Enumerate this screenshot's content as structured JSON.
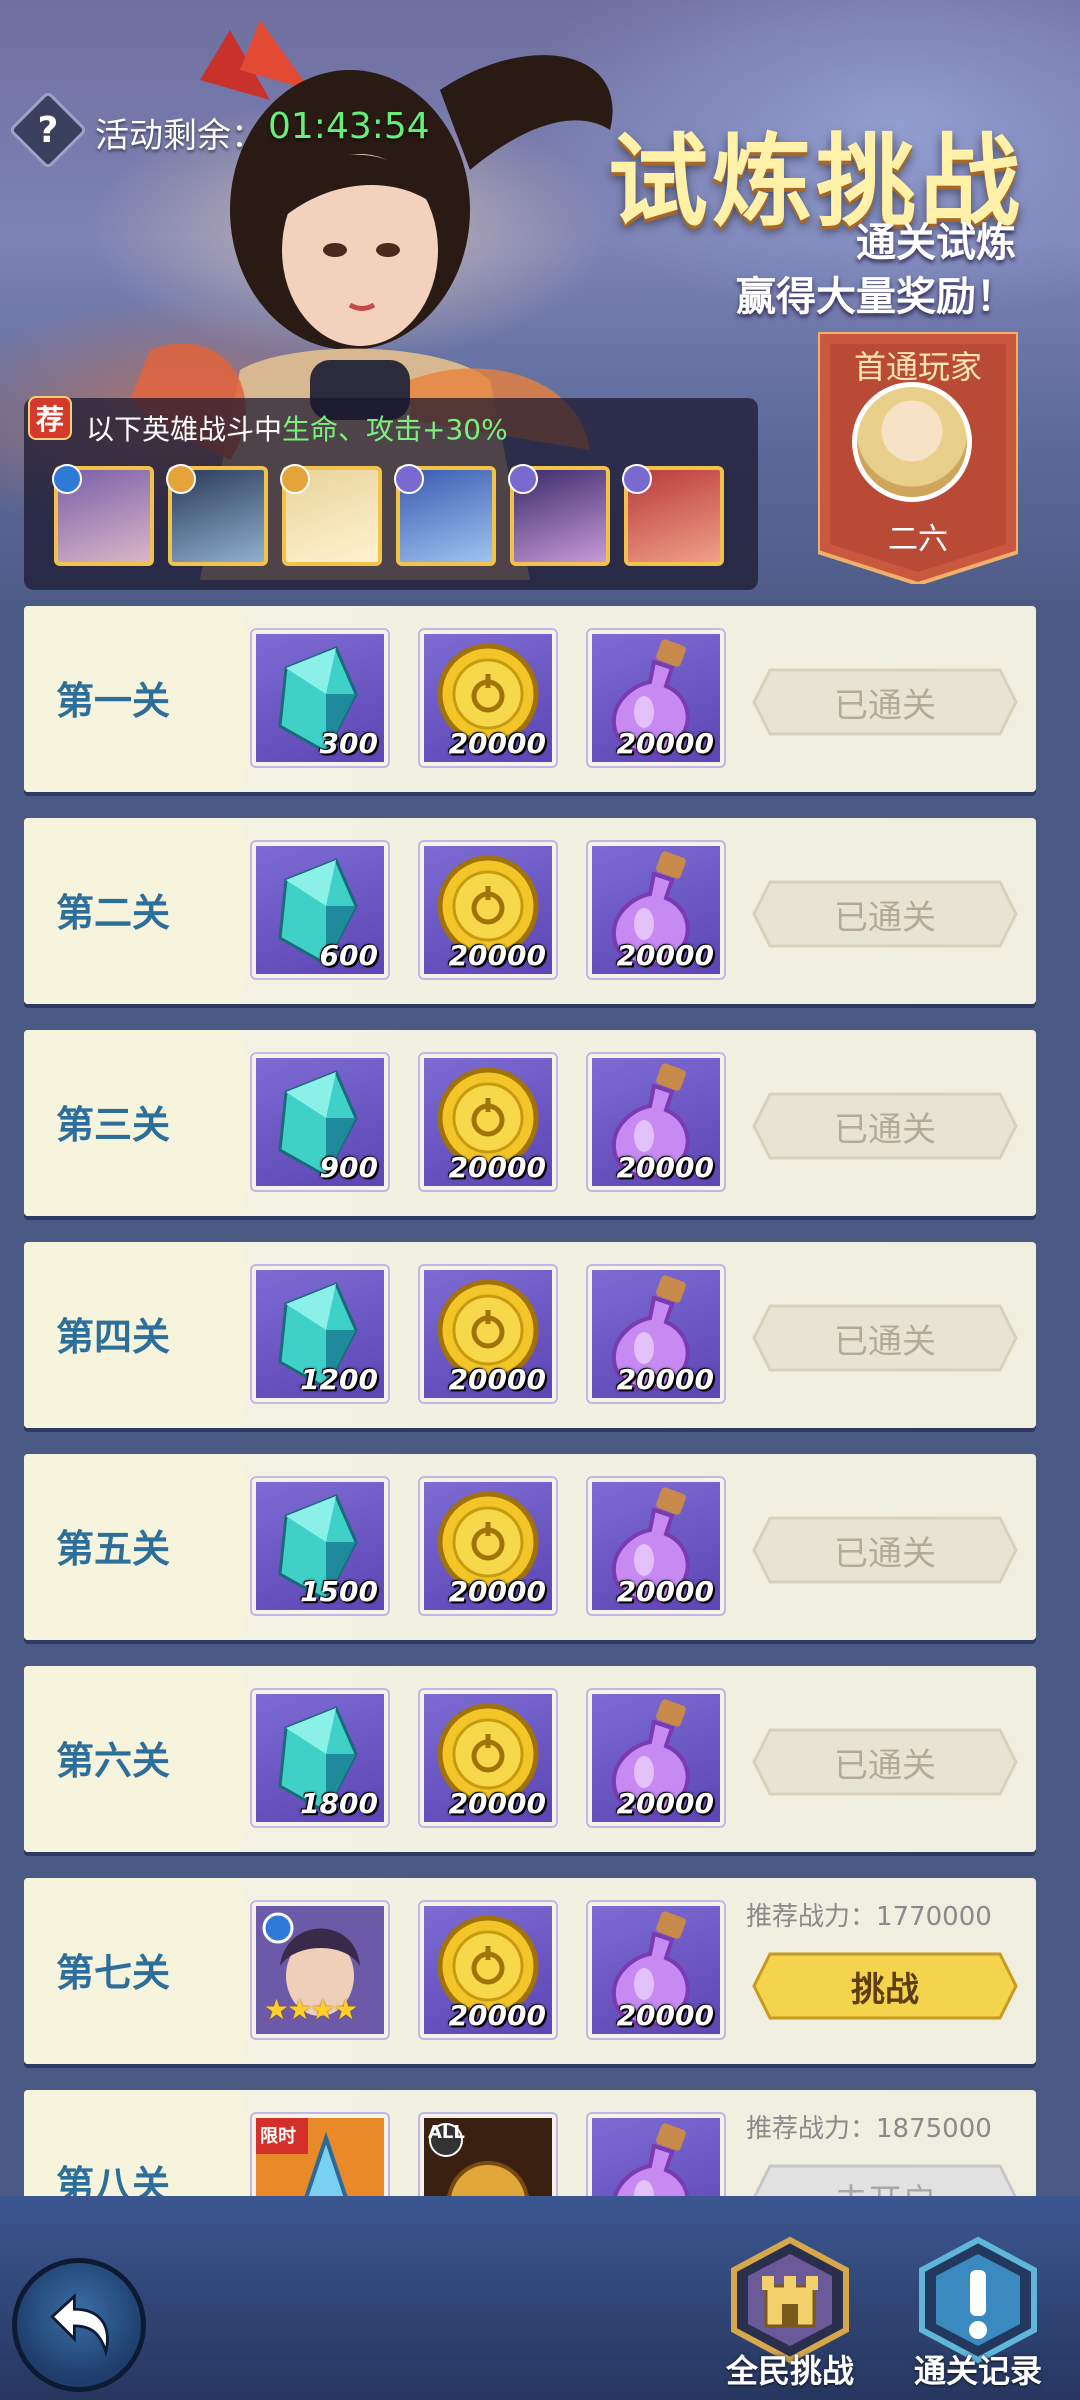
{
  "header": {
    "help_icon": "?",
    "timer_label": "活动剩余：",
    "timer_value": "01:43:54",
    "title": "试炼挑战",
    "subtitle_line1": "通关试炼",
    "subtitle_line2": "赢得大量奖励！"
  },
  "first_clear": {
    "label": "首通玩家",
    "player_name": "二六"
  },
  "bonus": {
    "tag": "荐",
    "text_prefix": "以下英雄战斗中",
    "text_highlight": "生命、攻击+30%",
    "heroes": [
      {
        "icon": "hero-portrait-icon",
        "element": "water-element-icon"
      },
      {
        "icon": "hero-portrait-icon",
        "element": "light-element-icon"
      },
      {
        "icon": "hero-portrait-icon",
        "element": "light-element-icon"
      },
      {
        "icon": "hero-portrait-icon",
        "element": "dark-element-icon"
      },
      {
        "icon": "hero-portrait-icon",
        "element": "dark-element-icon"
      },
      {
        "icon": "hero-portrait-icon",
        "element": "dark-element-icon"
      }
    ]
  },
  "stages": [
    {
      "name": "第一关",
      "rewards": [
        {
          "icon": "crystal-icon",
          "qty": "300"
        },
        {
          "icon": "gold-coin-icon",
          "qty": "20000"
        },
        {
          "icon": "potion-icon",
          "qty": "20000"
        }
      ],
      "status": "已通关"
    },
    {
      "name": "第二关",
      "rewards": [
        {
          "icon": "crystal-icon",
          "qty": "600"
        },
        {
          "icon": "gold-coin-icon",
          "qty": "20000"
        },
        {
          "icon": "potion-icon",
          "qty": "20000"
        }
      ],
      "status": "已通关"
    },
    {
      "name": "第三关",
      "rewards": [
        {
          "icon": "crystal-icon",
          "qty": "900"
        },
        {
          "icon": "gold-coin-icon",
          "qty": "20000"
        },
        {
          "icon": "potion-icon",
          "qty": "20000"
        }
      ],
      "status": "已通关"
    },
    {
      "name": "第四关",
      "rewards": [
        {
          "icon": "crystal-icon",
          "qty": "1200"
        },
        {
          "icon": "gold-coin-icon",
          "qty": "20000"
        },
        {
          "icon": "potion-icon",
          "qty": "20000"
        }
      ],
      "status": "已通关"
    },
    {
      "name": "第五关",
      "rewards": [
        {
          "icon": "crystal-icon",
          "qty": "1500"
        },
        {
          "icon": "gold-coin-icon",
          "qty": "20000"
        },
        {
          "icon": "potion-icon",
          "qty": "20000"
        }
      ],
      "status": "已通关"
    },
    {
      "name": "第六关",
      "rewards": [
        {
          "icon": "crystal-icon",
          "qty": "1800"
        },
        {
          "icon": "gold-coin-icon",
          "qty": "20000"
        },
        {
          "icon": "potion-icon",
          "qty": "20000"
        }
      ],
      "status": "已通关"
    },
    {
      "name": "第七关",
      "rewards": [
        {
          "icon": "hero-card-icon",
          "qty": "",
          "stars": "★★★★"
        },
        {
          "icon": "gold-coin-icon",
          "qty": "20000"
        },
        {
          "icon": "potion-icon",
          "qty": "20000"
        }
      ],
      "power": "推荐战力：1770000",
      "status": "挑战"
    },
    {
      "name": "第八关",
      "rewards": [
        {
          "icon": "limited-item-icon",
          "qty": "",
          "badge": "限时"
        },
        {
          "icon": "helmet-icon",
          "qty": "",
          "badge": "ALL"
        },
        {
          "icon": "potion-icon",
          "qty": ""
        }
      ],
      "power": "推荐战力：1875000",
      "status": "未开启"
    }
  ],
  "bottom_nav": {
    "back_icon": "back-arrow-icon",
    "all_challenge_label": "全民挑战",
    "clear_record_label": "通关记录"
  },
  "colors": {
    "cleared_text": "#b4ab96",
    "challenge_button": "#f4d44c",
    "stage_name": "#2d6e9a",
    "timer": "#66f07a"
  }
}
